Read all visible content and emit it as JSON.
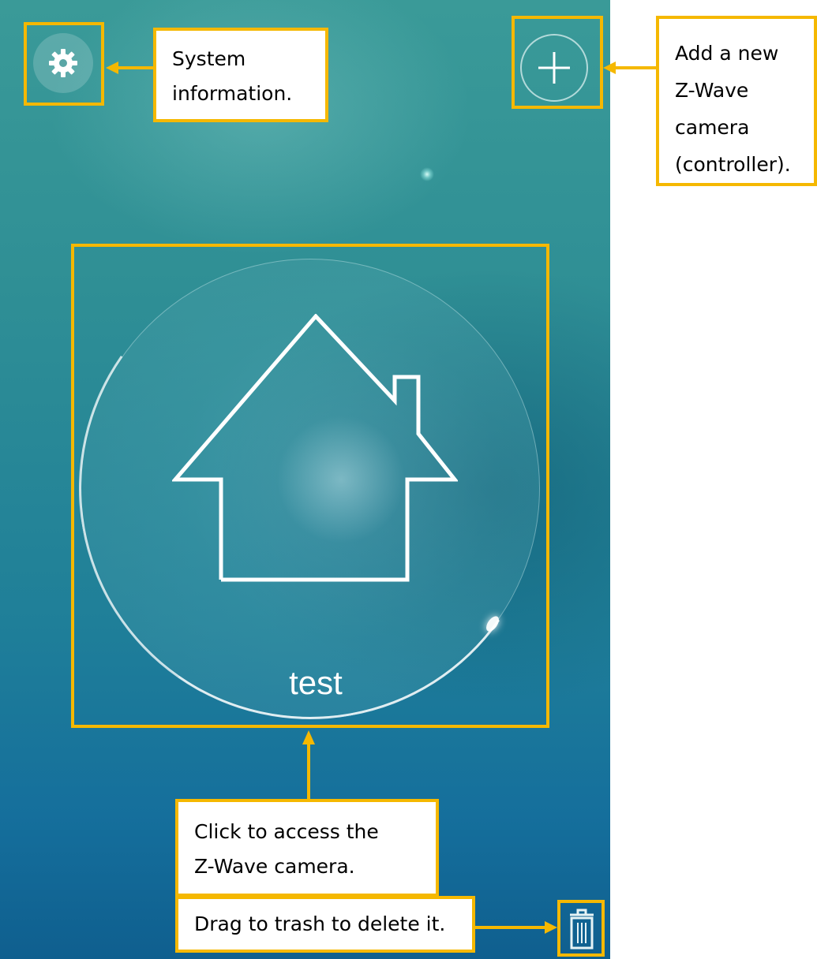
{
  "screen": {
    "tile_label": "test"
  },
  "annotations": {
    "system_info": "System information.",
    "add_camera": "Add a new Z-Wave camera (controller).",
    "access_camera": "Click to access the Z-Wave camera.",
    "delete_hint": "Drag to trash to delete it."
  },
  "colors": {
    "annotation_border": "#f5b800",
    "background_top": "#3a9a98",
    "background_bottom": "#0f5f8f"
  },
  "icons": {
    "settings": "gear-icon",
    "add": "plus-icon",
    "home": "house-icon",
    "trash": "trash-icon"
  }
}
